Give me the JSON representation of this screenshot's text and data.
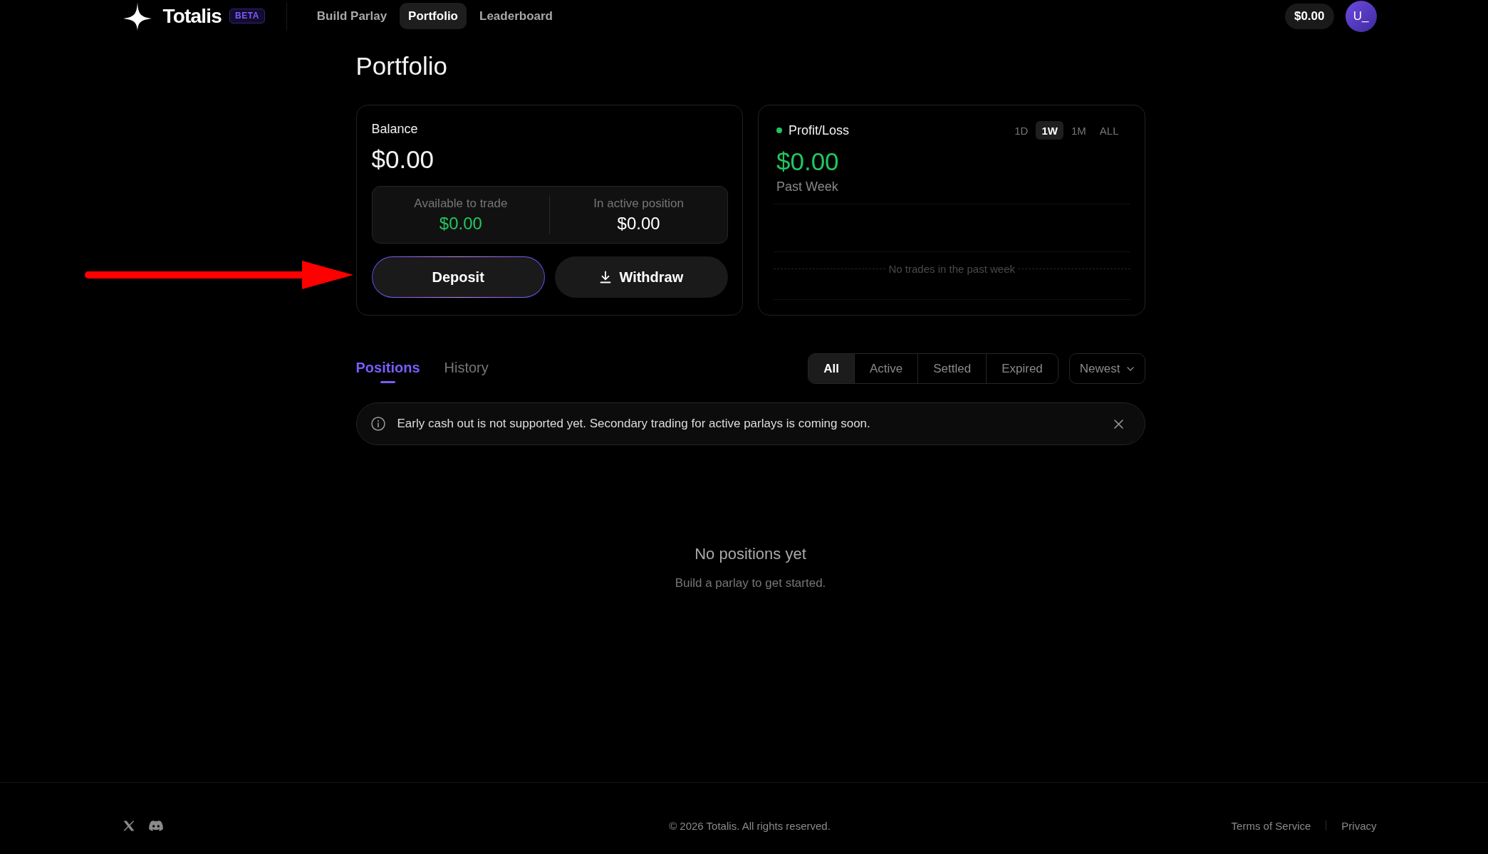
{
  "header": {
    "logo": {
      "name": "Totalis",
      "badge": "BETA"
    },
    "nav": [
      {
        "label": "Build Parlay",
        "selected": false
      },
      {
        "label": "Portfolio",
        "selected": true
      },
      {
        "label": "Leaderboard",
        "selected": false
      }
    ],
    "balance": "$0.00",
    "avatar": "U_"
  },
  "page_title": "Portfolio",
  "balance_card": {
    "title": "Balance",
    "amount": "$0.00",
    "breakdown": [
      {
        "label": "Available to trade",
        "value": "$0.00",
        "color": "#22c55e"
      },
      {
        "label": "In active position",
        "value": "$0.00",
        "color": "#ffffff"
      }
    ],
    "buttons": [
      {
        "label": "Deposit",
        "kind": "accent"
      },
      {
        "label": "Withdraw",
        "kind": "download"
      }
    ]
  },
  "pnl_card": {
    "title": "Profit/Loss",
    "periods": [
      {
        "label": "1D",
        "selected": false
      },
      {
        "label": "1W",
        "selected": true
      },
      {
        "label": "1M",
        "selected": false
      },
      {
        "label": "ALL",
        "selected": false
      }
    ],
    "amount": "$0.00",
    "caption": "Past Week",
    "empty_message": "No trades in the past week"
  },
  "positions": {
    "tabs": [
      {
        "label": "Positions",
        "selected": true
      },
      {
        "label": "History",
        "selected": false
      }
    ],
    "filters": [
      {
        "label": "All",
        "selected": true
      },
      {
        "label": "Active",
        "selected": false
      },
      {
        "label": "Settled",
        "selected": false
      },
      {
        "label": "Expired",
        "selected": false
      }
    ],
    "sort": {
      "value": "Newest"
    },
    "notice": {
      "text": "Early cash out is not supported yet. Secondary trading for active parlays is coming soon."
    },
    "empty_state": {
      "title": "No positions yet",
      "subtitle": "Build a parlay to get started."
    }
  },
  "footer": {
    "copyright": "© 2026 Totalis. All rights reserved.",
    "links": [
      "Terms of Service",
      "Privacy"
    ]
  },
  "annotations": [
    {
      "kind": "arrow"
    }
  ]
}
